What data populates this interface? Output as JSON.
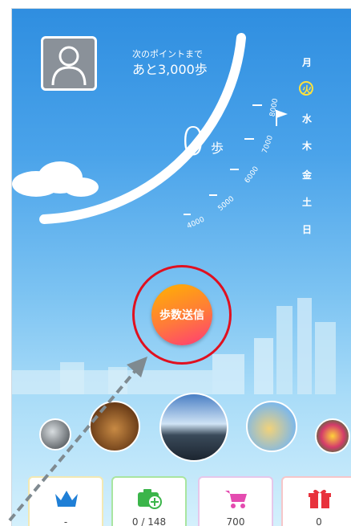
{
  "header": {
    "next_point_label": "次のポイントまで",
    "next_point_value": "あと3,000歩"
  },
  "steps": {
    "count": "0",
    "unit": "歩"
  },
  "gauge_ticks": [
    "4000",
    "5000",
    "6000",
    "7000",
    "8000"
  ],
  "week_days": [
    {
      "label": "月",
      "today": false
    },
    {
      "label": "火",
      "today": true
    },
    {
      "label": "水",
      "today": false
    },
    {
      "label": "木",
      "today": false
    },
    {
      "label": "金",
      "today": false
    },
    {
      "label": "土",
      "today": false
    },
    {
      "label": "日",
      "today": false
    }
  ],
  "send_button": {
    "label": "歩数送信"
  },
  "cards": [
    {
      "icon": "crown-icon",
      "value": "-"
    },
    {
      "icon": "camera-plus-icon",
      "value": "0 / 148"
    },
    {
      "icon": "cart-icon",
      "value": "700"
    },
    {
      "icon": "gift-icon",
      "value": "0"
    }
  ],
  "colors": {
    "highlight": "#e0101f",
    "today": "#ffe23b",
    "accent_crown": "#1f7fd6"
  }
}
